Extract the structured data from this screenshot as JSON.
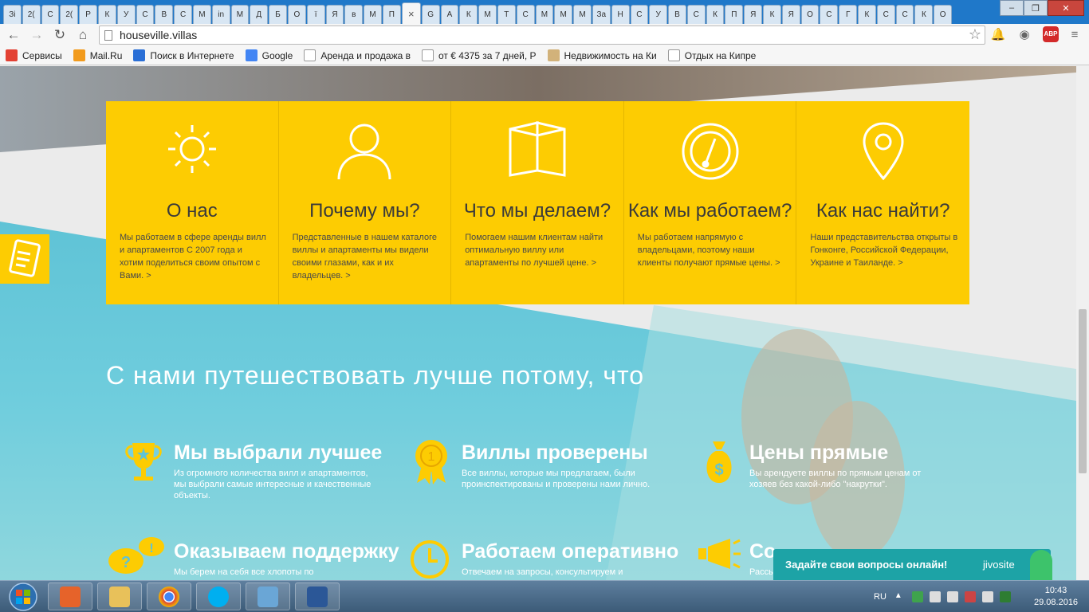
{
  "browser": {
    "tabs": [
      "Зі",
      "2(",
      "С",
      "2(",
      "Р",
      "К",
      "У",
      "С",
      "В",
      "С",
      "М",
      "in",
      "М",
      "Д",
      "Б",
      "О",
      "ï",
      "Я",
      "в",
      "М",
      "П",
      "×",
      "G",
      "А",
      "К",
      "М",
      "Т",
      "С",
      "М",
      "М",
      "М",
      "За",
      "Н",
      "С",
      "У",
      "В",
      "С",
      "К",
      "П",
      "Я",
      "К",
      "Я",
      "О",
      "С",
      "Г",
      "К",
      "С",
      "С",
      "К",
      "О"
    ],
    "url": "houseville.villas",
    "bookmarks": [
      {
        "label": "Сервисы",
        "icon": "apps-grid-icon",
        "color": "#e34133"
      },
      {
        "label": "Mail.Ru",
        "icon": "mailru-icon",
        "color": "#f29b1d"
      },
      {
        "label": "Поиск в Интернете",
        "icon": "search-icon",
        "color": "#2a6fd6"
      },
      {
        "label": "Google",
        "icon": "google-icon",
        "color": "#4285f4"
      },
      {
        "label": "Аренда и продажа в",
        "icon": "page-icon",
        "color": "#ffffff"
      },
      {
        "label": "от € 4375 за 7 дней, Р",
        "icon": "page-icon",
        "color": "#ffffff"
      },
      {
        "label": "Недвижимость на Ки",
        "icon": "shield-icon",
        "color": "#d2b27a"
      },
      {
        "label": "Отдых на Кипре",
        "icon": "page-icon",
        "color": "#ffffff"
      }
    ],
    "abp_label": "ABP"
  },
  "cards": [
    {
      "title": "О нас",
      "text": "Мы работаем в сфере аренды вилл и апартаментов С 2007 года и хотим поделиться своим опытом с Вами. >",
      "icon": "sun-icon"
    },
    {
      "title": "Почему мы?",
      "text": "Представленные в нашем каталоге виллы и апартаменты мы видели своими глазами, как и их владельцев. >",
      "icon": "person-icon"
    },
    {
      "title": "Что мы делаем?",
      "text": "Помогаем нашим клиентам найти оптимальную виллу или апартаменты по лучшей цене. >",
      "icon": "book-icon"
    },
    {
      "title": "Как мы работаем?",
      "text": "Мы работаем напрямую с владельцами, поэтому наши клиенты получают прямые цены. >",
      "icon": "gauge-icon"
    },
    {
      "title": "Как нас найти?",
      "text": "Наши представительства открыты в Гонконге, Российской Федерации, Украине и Таиланде. >",
      "icon": "map-pin-icon"
    }
  ],
  "headline": "С нами путешествовать лучше потому, что",
  "features": [
    {
      "title": "Мы выбрали лучшее",
      "text": "Из огромного количества вилл и апартаментов, мы выбрали самые интересные и качественные объекты.",
      "icon": "trophy-icon"
    },
    {
      "title": "Виллы проверены",
      "text": "Все виллы, которые мы предлагаем, были проинспектированы и проверены нами лично.",
      "icon": "medal-icon"
    },
    {
      "title": "Цены прямые",
      "text": "Вы арендуете виллы по прямым ценам от хозяев без какой-либо \"накрутки\".",
      "icon": "money-bag-icon"
    },
    {
      "title": "Оказываем поддержку",
      "text": "Мы берем на себя все хлопоты по",
      "icon": "speech-bubbles-icon"
    },
    {
      "title": "Работаем оперативно",
      "text": "Отвечаем на запросы, консультируем и",
      "icon": "clock-icon"
    },
    {
      "title": "Со",
      "text": "Рассы",
      "icon": "megaphone-icon"
    }
  ],
  "chat": {
    "label": "Задайте свои вопросы онлайн!",
    "brand": "jivosite"
  },
  "taskbar": {
    "lang": "RU",
    "time": "10:43",
    "date": "29.08.2016"
  },
  "colors": {
    "accent_yellow": "#fdcc02",
    "sea": "#5fc7d9",
    "chat": "#1da3a6"
  }
}
